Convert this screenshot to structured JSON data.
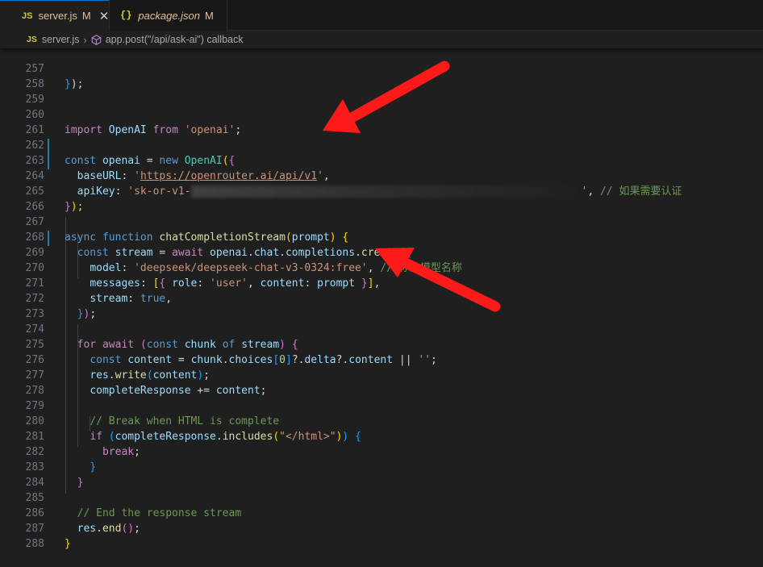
{
  "tabs": [
    {
      "badge": "JS",
      "name": "server.js",
      "status": "M",
      "close": "✕",
      "active": true
    },
    {
      "badge": "{}",
      "name": "package.json",
      "status": "M",
      "active": false
    }
  ],
  "breadcrumb": {
    "file_badge": "JS",
    "file": "server.js",
    "separator": "›",
    "symbol": "app.post(\"/api/ask-ai\") callback"
  },
  "editor": {
    "line_numbers": [
      "257",
      "258",
      "259",
      "260",
      "261",
      "262",
      "263",
      "264",
      "265",
      "266",
      "267",
      "268",
      "269",
      "270",
      "271",
      "272",
      "273",
      "274",
      "275",
      "276",
      "277",
      "278",
      "279",
      "280",
      "281",
      "282",
      "283",
      "284",
      "285",
      "286",
      "287",
      "288"
    ],
    "tokens": {
      "close_paren_semi": ");",
      "close_brace": "}",
      "close_brace_semi": "});",
      "import": "import",
      "openai_cls": "OpenAI",
      "from": "from",
      "openai_pkg": "'openai'",
      "semi": ";",
      "const": "const",
      "openai_var": "openai",
      "eq": "=",
      "new": "new",
      "open_paren": "(",
      "open_brace": "{",
      "baseurl_key": "baseURL",
      "colon": ":",
      "quote": "'",
      "base_url": "https://openrouter.ai/api/v1",
      "comma": ",",
      "apikey_key": "apiKey",
      "apikey_prefix": "'sk-or-v1-",
      "apikey_suffix": "'",
      "apikey_comment": "// 如果需要认证",
      "async": "async",
      "function": "function",
      "fn_name": "chatCompletionStream",
      "prompt": "prompt",
      "stream": "stream",
      "await": "await",
      "chat": "chat",
      "completions": "completions",
      "create": "create",
      "dot": ".",
      "model_key": "model",
      "model_val": "'deepseek/deepseek-chat-v3-0324:free'",
      "model_comment": "// 你的模型名称",
      "messages_key": "messages",
      "open_bracket": "[",
      "close_bracket": "]",
      "role_key": "role",
      "role_val": "'user'",
      "content_key": "content",
      "stream_key": "stream",
      "true": "true",
      "for": "for",
      "of": "of",
      "chunk": "chunk",
      "content": "content",
      "choices": "choices",
      "zero": "0",
      "qdot": "?.",
      "delta": "delta",
      "or": "||",
      "empty_str": "''",
      "res": "res",
      "write": "write",
      "completeResponse": "completeResponse",
      "plus_eq": "+=",
      "break_comment": "// Break when HTML is complete",
      "if": "if",
      "includes": "includes",
      "html_str": "\"</html>\"",
      "close_parens_x2": "))",
      "break": "break",
      "end_comment": "// End the response stream",
      "end": "end",
      "parens": "()"
    }
  },
  "annotations": {
    "arrow_color": "#ff1a1a",
    "count": 2
  },
  "colors": {
    "keyword": "#569cd6",
    "control": "#c586c0",
    "function": "#dcdcaa",
    "variable": "#9cdcfe",
    "string": "#ce9178",
    "comment": "#6a9955",
    "class": "#4ec9b0"
  }
}
